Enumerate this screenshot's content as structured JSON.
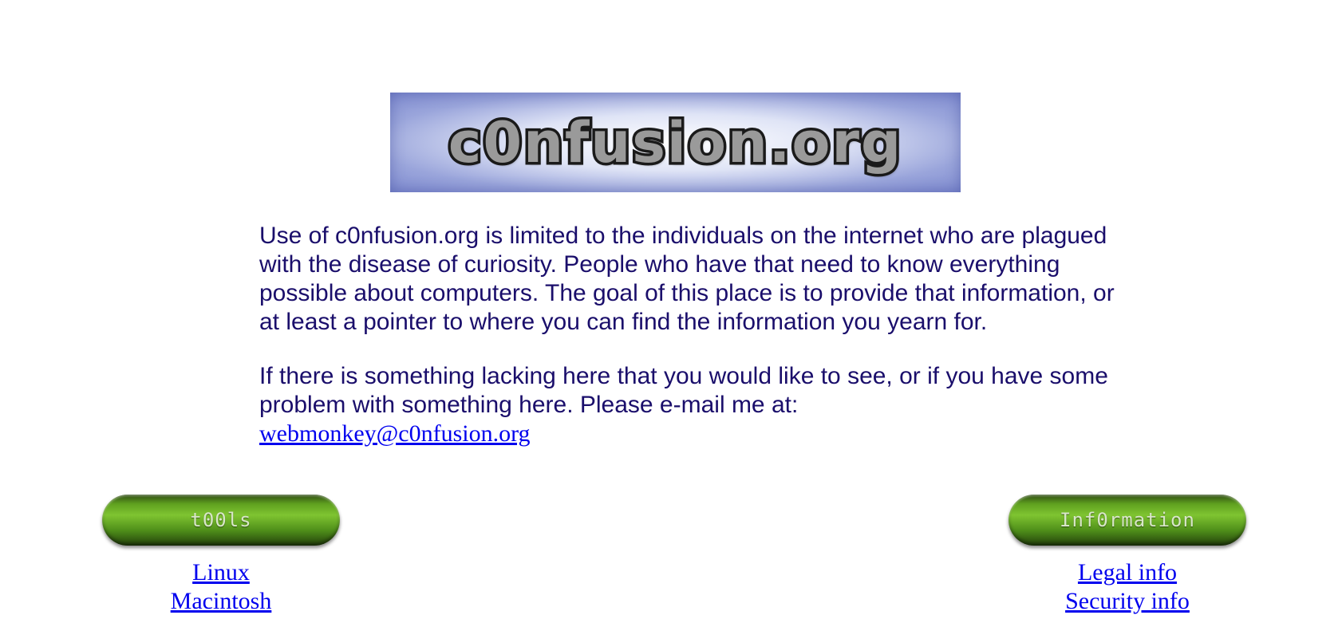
{
  "logo": {
    "text": "c0nfusion.org"
  },
  "intro": {
    "paragraph1": "Use of c0nfusion.org is limited to the individuals on the internet who are plagued with the disease of curiosity. People who have that need to know everything possible about computers. The goal of this place is to provide that information, or at least a pointer to where you can find the information you yearn for.",
    "paragraph2": "If there is something lacking here that you would like to see, or if you have some problem with something here. Please e-mail me at:",
    "email": "webmonkey@c0nfusion.org"
  },
  "nav": {
    "tools_label": "t00ls",
    "information_label": "Inf0rmation",
    "tools_links": [
      "Linux",
      "Macintosh"
    ],
    "info_links": [
      "Legal info",
      "Security info"
    ]
  },
  "colors": {
    "text": "#1a0e6b",
    "link": "#0000ee",
    "button_green": "#5fa01f",
    "banner_blue": "#8f9bd8"
  }
}
